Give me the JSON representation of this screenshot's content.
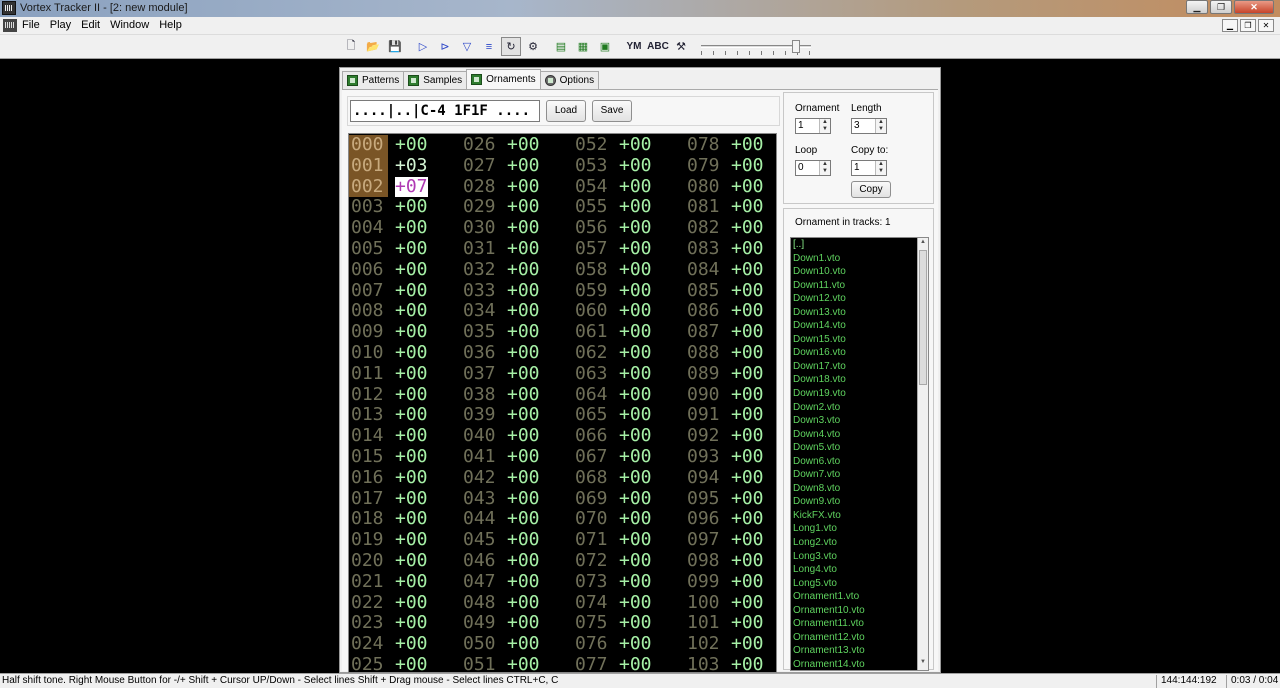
{
  "window": {
    "title": "Vortex Tracker II - [2: new module]"
  },
  "menu": [
    "File",
    "Play",
    "Edit",
    "Window",
    "Help"
  ],
  "toolbar": {
    "buttons": [
      "new-file",
      "open-file",
      "save-file",
      "play",
      "play-from-start",
      "stop",
      "toggle-loop",
      "follow-song",
      "tracks-manager",
      "new-pattern",
      "insert-pattern",
      "delete-pattern",
      "ym-chip",
      "abc-channels",
      "options"
    ],
    "labels": {
      "ym": "YM",
      "abc": "ABC"
    },
    "volume_level": 0.86
  },
  "tabs": [
    {
      "label": "Patterns",
      "active": false
    },
    {
      "label": "Samples",
      "active": false
    },
    {
      "label": "Ornaments",
      "active": true
    },
    {
      "label": "Options",
      "active": false
    }
  ],
  "test_line": "....|..|C-4 1F1F ....",
  "buttons": {
    "load": "Load",
    "save": "Save",
    "copy": "Copy"
  },
  "params": {
    "ornament_label": "Ornament",
    "ornament_value": "1",
    "length_label": "Length",
    "length_value": "3",
    "loop_label": "Loop",
    "loop_value": "0",
    "copy_to_label": "Copy to:",
    "copy_to_value": "1"
  },
  "tracks_label": "Ornament in tracks: 1",
  "files": [
    "[..]",
    "Down1.vto",
    "Down10.vto",
    "Down11.vto",
    "Down12.vto",
    "Down13.vto",
    "Down14.vto",
    "Down15.vto",
    "Down16.vto",
    "Down17.vto",
    "Down18.vto",
    "Down19.vto",
    "Down2.vto",
    "Down3.vto",
    "Down4.vto",
    "Down5.vto",
    "Down6.vto",
    "Down7.vto",
    "Down8.vto",
    "Down9.vto",
    "KickFX.vto",
    "Long1.vto",
    "Long2.vto",
    "Long3.vto",
    "Long4.vto",
    "Long5.vto",
    "Ornament1.vto",
    "Ornament10.vto",
    "Ornament11.vto",
    "Ornament12.vto",
    "Ornament13.vto",
    "Ornament14.vto"
  ],
  "ornament": {
    "highlight_rows": 3,
    "cursor_row": 2,
    "values": [
      "+00",
      "+03",
      "+07"
    ],
    "default_value": "+00",
    "columns": [
      {
        "start": 0,
        "count": 26
      },
      {
        "start": 26,
        "count": 26
      },
      {
        "start": 52,
        "count": 26
      },
      {
        "start": 78,
        "count": 26
      }
    ]
  },
  "status": {
    "hint": "Half shift tone.  Right Mouse Button for -/+ Shift + Cursor UP/Down - Select lines Shift + Drag mouse - Select lines  CTRL+C, C",
    "position": "144:144:192",
    "time": "0:03 / 0:04"
  }
}
